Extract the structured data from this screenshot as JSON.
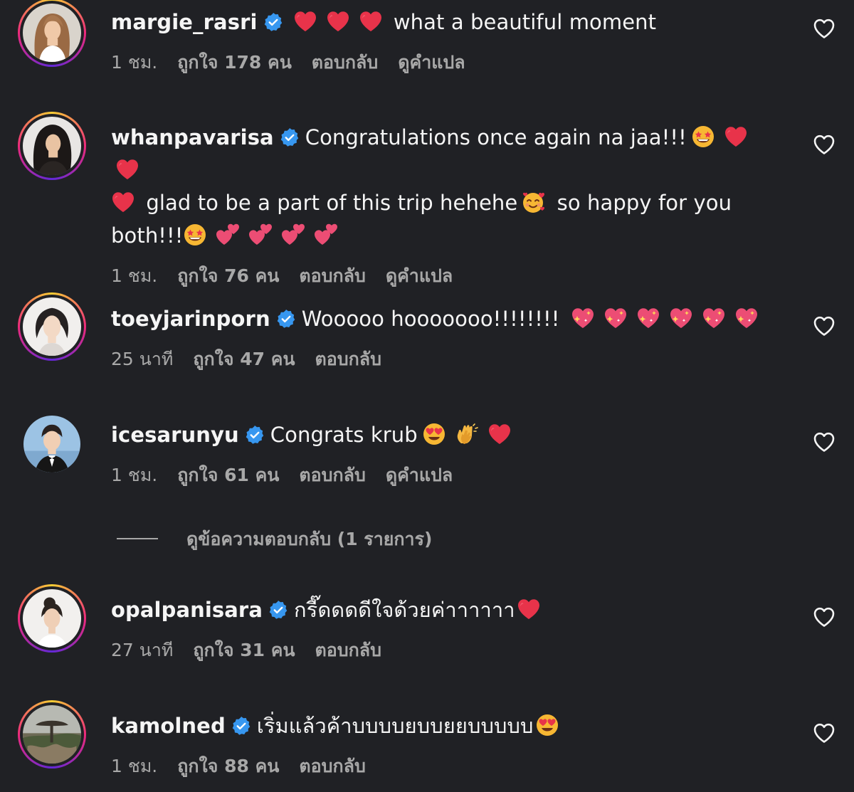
{
  "comments": [
    {
      "username": "margie_rasri",
      "text": "what a beautiful moment",
      "time": "1 ชม.",
      "likes": "ถูกใจ 178 คน",
      "reply": "ตอบกลับ",
      "translate": "ดูคำแปล"
    },
    {
      "username": "whanpavarisa",
      "text_part1": "Congratulations once again na jaa!!!",
      "text_part2": "glad to be a part of this trip hehehe",
      "text_part3": "so happy for you",
      "text_part4": "both!!!",
      "time": "1 ชม.",
      "likes": "ถูกใจ 76 คน",
      "reply": "ตอบกลับ",
      "translate": "ดูคำแปล"
    },
    {
      "username": "toeyjarinporn",
      "text": "Wooooo hooooooo!!!!!!!!",
      "time": "25 นาที",
      "likes": "ถูกใจ 47 คน",
      "reply": "ตอบกลับ"
    },
    {
      "username": "icesarunyu",
      "text": "Congrats krub",
      "time": "1 ชม.",
      "likes": "ถูกใจ 61 คน",
      "reply": "ตอบกลับ",
      "translate": "ดูคำแปล"
    },
    {
      "username": "opalpanisara",
      "text": "กรี๊ดดดดีใจด้วยค่าาาาาา",
      "time": "27 นาที",
      "likes": "ถูกใจ 31 คน",
      "reply": "ตอบกลับ"
    },
    {
      "username": "kamolned",
      "text": "เริ่มแล้วค้าบบบบยบบยยบบบบบ",
      "time": "1 ชม.",
      "likes": "ถูกใจ 88 คน",
      "reply": "ตอบกลับ"
    }
  ],
  "view_replies": "ดูข้อความตอบกลับ (1 รายการ)",
  "icons": {
    "verified": "verified-badge-icon",
    "like": "heart-outline-icon",
    "emoji_heart": "red-heart-emoji",
    "emoji_star_eyes": "star-struck-emoji",
    "emoji_hearts_face": "smiling-face-with-hearts-emoji",
    "emoji_two_hearts": "two-hearts-emoji",
    "emoji_sparkling_heart": "sparkling-heart-emoji",
    "emoji_heart_eyes": "heart-eyes-emoji",
    "emoji_clap": "clapping-hands-emoji"
  },
  "colors": {
    "background": "#202125",
    "text": "#f5f5f5",
    "secondary": "#a8a8a8",
    "verified": "#3797f0",
    "heart": "#e8334a"
  }
}
